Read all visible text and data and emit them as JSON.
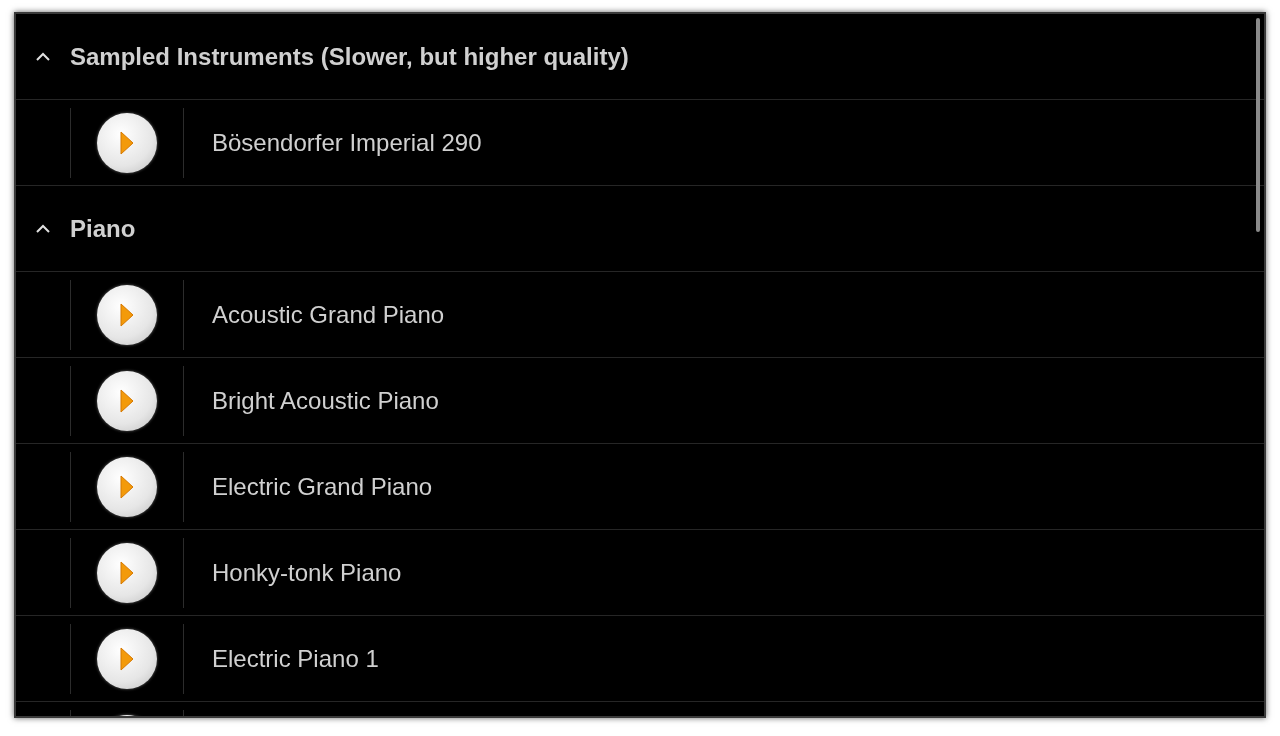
{
  "groups": [
    {
      "title": "Sampled Instruments (Slower, but higher quality)",
      "expanded": true,
      "items": [
        {
          "name": "Bösendorfer Imperial 290"
        }
      ]
    },
    {
      "title": "Piano",
      "expanded": true,
      "items": [
        {
          "name": "Acoustic Grand Piano"
        },
        {
          "name": "Bright Acoustic Piano"
        },
        {
          "name": "Electric Grand Piano"
        },
        {
          "name": "Honky-tonk Piano"
        },
        {
          "name": "Electric Piano 1"
        }
      ],
      "more_below": true
    }
  ]
}
